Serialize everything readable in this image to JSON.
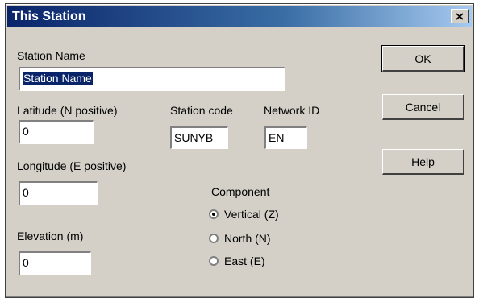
{
  "window": {
    "title": "This Station",
    "close_glyph": "close-icon"
  },
  "form": {
    "station_name": {
      "label": "Station Name",
      "value": "Station Name"
    },
    "latitude": {
      "label": "Latitude (N positive)",
      "value": "0"
    },
    "station_code": {
      "label": "Station code",
      "value": "SUNYB"
    },
    "network_id": {
      "label": "Network ID",
      "value": "EN"
    },
    "longitude": {
      "label": "Longitude (E positive)",
      "value": "0"
    },
    "elevation": {
      "label": "Elevation (m)",
      "value": "0"
    }
  },
  "component": {
    "label": "Component",
    "selected": "Vertical (Z)",
    "options": [
      "Vertical (Z)",
      "North (N)",
      "East (E)"
    ]
  },
  "buttons": {
    "ok": "OK",
    "cancel": "Cancel",
    "help": "Help"
  }
}
